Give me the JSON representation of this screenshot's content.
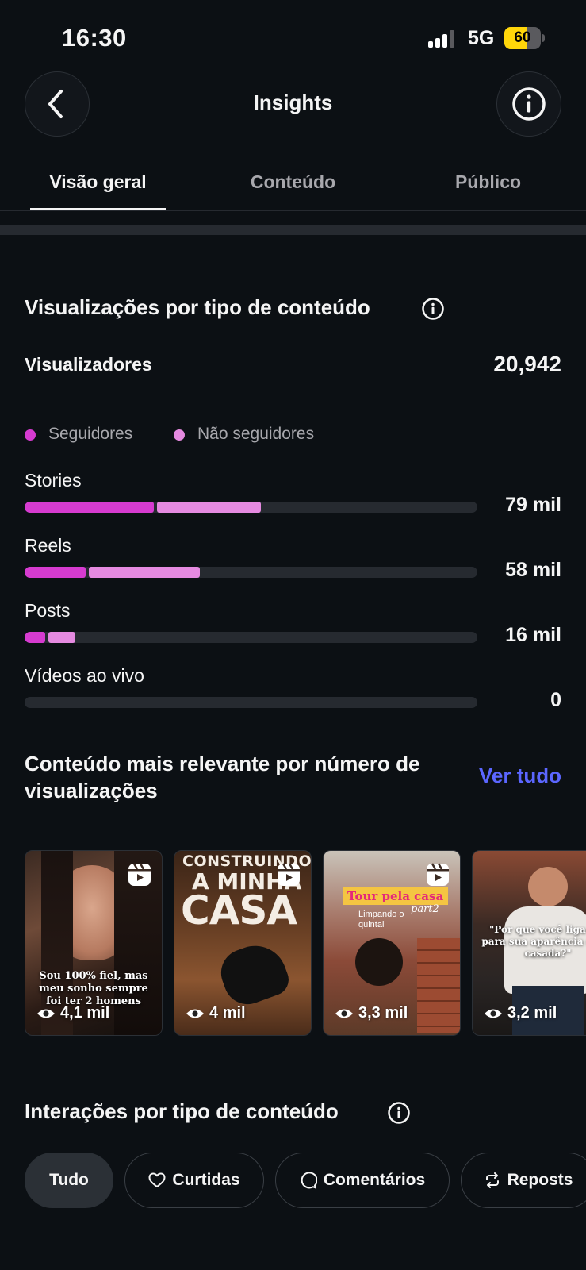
{
  "status_bar": {
    "time": "16:30",
    "network": "5G",
    "battery_level": "60",
    "battery_fraction": 0.6,
    "battery_color": "#ffd60a"
  },
  "header": {
    "title": "Insights",
    "back_icon": "chevron-left-icon",
    "info_icon": "info-icon"
  },
  "tabs": [
    {
      "label": "Visão geral",
      "active": true
    },
    {
      "label": "Conteúdo",
      "active": false
    },
    {
      "label": "Público",
      "active": false
    }
  ],
  "views_by_type": {
    "title": "Visualizações por tipo de conteúdo",
    "viewers_label": "Visualizadores",
    "viewers_value": "20,942",
    "legend": [
      {
        "label": "Seguidores",
        "color": "#d63bd0"
      },
      {
        "label": "Não seguidores",
        "color": "#e58ae0"
      }
    ],
    "rows": [
      {
        "label": "Stories",
        "value": "79 mil",
        "followers_fraction": 0.285,
        "non_followers_fraction": 0.23
      },
      {
        "label": "Reels",
        "value": "58 mil",
        "followers_fraction": 0.135,
        "non_followers_fraction": 0.245
      },
      {
        "label": "Posts",
        "value": "16 mil",
        "followers_fraction": 0.045,
        "non_followers_fraction": 0.06
      },
      {
        "label": "Vídeos ao vivo",
        "value": "0",
        "followers_fraction": 0,
        "non_followers_fraction": 0
      }
    ]
  },
  "top_content": {
    "title": "Conteúdo mais relevante por número de visualizações",
    "see_all": "Ver tudo",
    "items": [
      {
        "views": "4,1 mil",
        "caption": "Sou 100% fiel, mas meu sonho sempre foi ter 2 homens",
        "type": "reel-icon"
      },
      {
        "views": "4 mil",
        "overlay_top": "CONSTRUINDO",
        "overlay_mid": "A MINHA",
        "overlay_big": "CASA",
        "type": "reel-icon"
      },
      {
        "views": "3,3 mil",
        "overlay_tag": "Tour pela casa",
        "overlay_sub": "Limpando o quintal",
        "overlay_part": "part2",
        "type": "reel-icon"
      },
      {
        "views": "3,2 mil",
        "caption": "\"Por que você liga tan para sua aparência s já é casada?\"",
        "type": "reel-icon"
      }
    ]
  },
  "interactions": {
    "title": "Interações por tipo de conteúdo",
    "chips": [
      {
        "label": "Tudo",
        "active": true
      },
      {
        "label": "Curtidas",
        "icon": "heart-icon"
      },
      {
        "label": "Comentários",
        "icon": "comment-icon"
      },
      {
        "label": "Reposts",
        "icon": "repost-icon"
      }
    ]
  }
}
